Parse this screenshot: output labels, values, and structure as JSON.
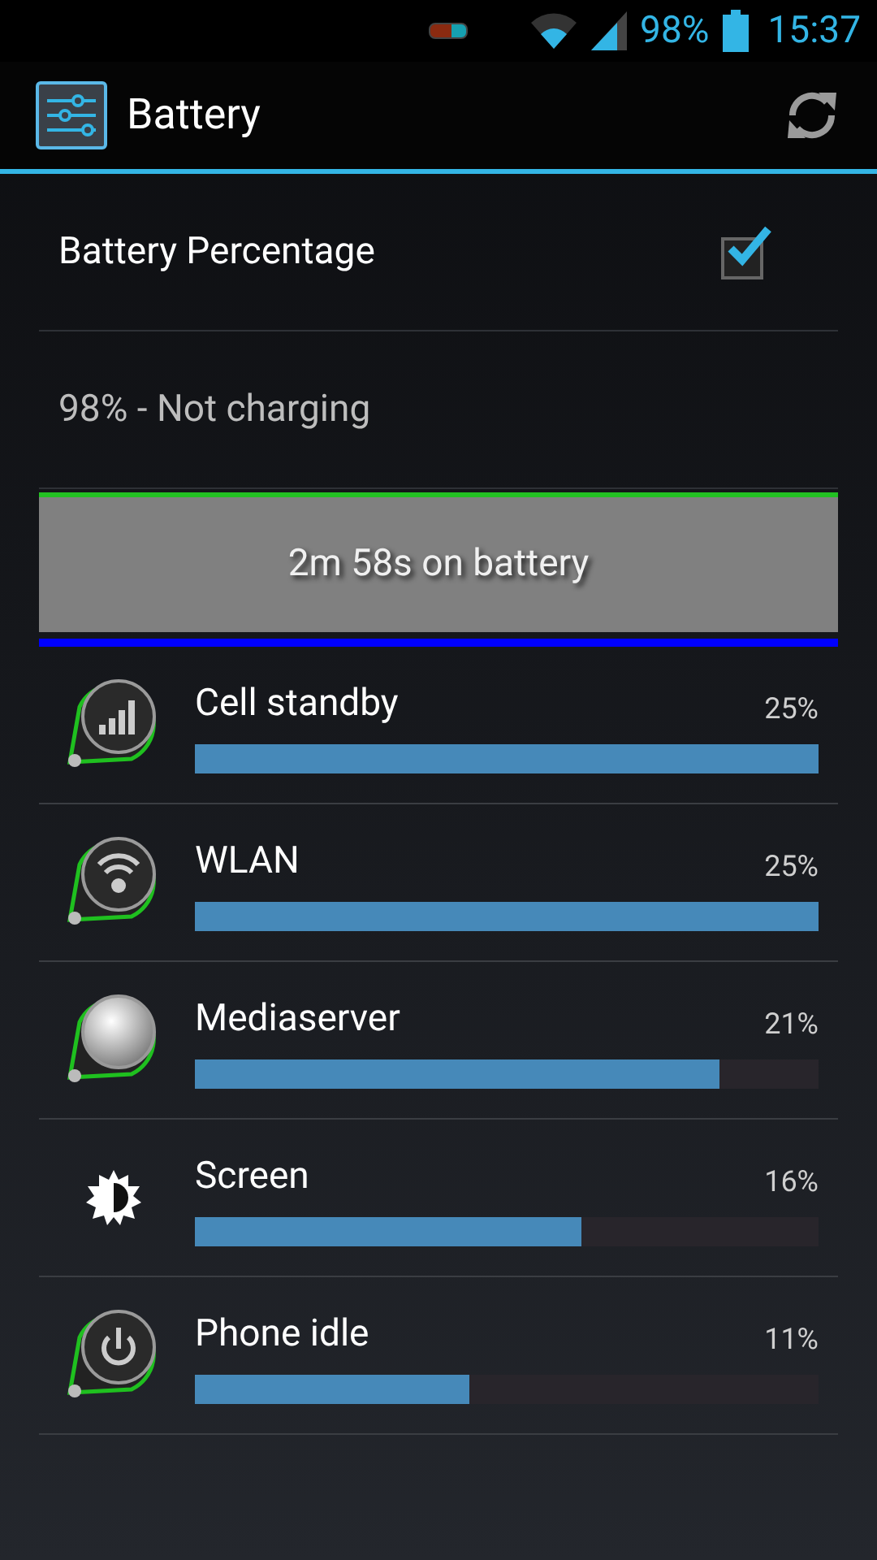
{
  "status_bar": {
    "battery": "98%",
    "time": "15:37"
  },
  "action_bar": {
    "title": "Battery"
  },
  "battery_percentage": {
    "label": "Battery Percentage",
    "checked": true
  },
  "charge_status": "98% - Not charging",
  "history_graph": {
    "label": "2m 58s on battery"
  },
  "usage": [
    {
      "kind": "signal",
      "name": "Cell standby",
      "percent": "25%",
      "level": 1.0
    },
    {
      "kind": "wifi",
      "name": "WLAN",
      "percent": "25%",
      "level": 1.0
    },
    {
      "kind": "media",
      "name": "Mediaserver",
      "percent": "21%",
      "level": 0.84
    },
    {
      "kind": "brightness",
      "name": "Screen",
      "percent": "16%",
      "level": 0.62
    },
    {
      "kind": "power",
      "name": "Phone idle",
      "percent": "11%",
      "level": 0.44
    }
  ]
}
